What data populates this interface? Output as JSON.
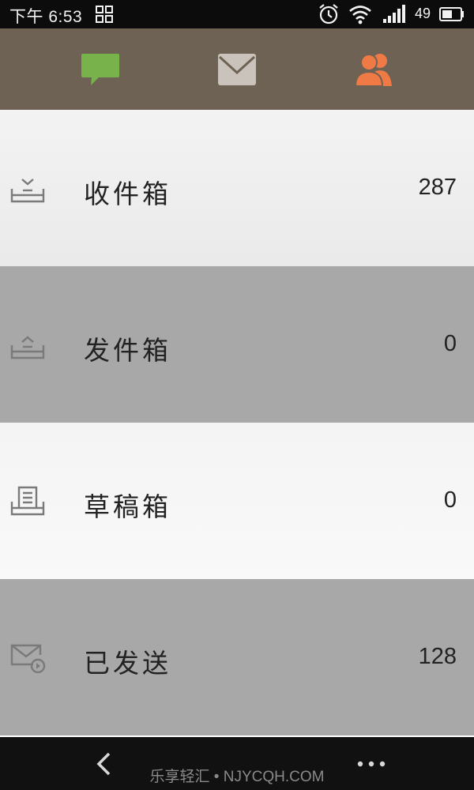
{
  "status_bar": {
    "time": "下午 6:53",
    "battery_level": "49",
    "icons": [
      "grid-icon",
      "alarm-icon",
      "wifi-icon",
      "signal-icon",
      "battery-icon"
    ]
  },
  "tabs": [
    {
      "name": "messages",
      "icon": "chat-bubble-icon",
      "color": "#77b24b"
    },
    {
      "name": "mail",
      "icon": "envelope-icon",
      "color": "#c9c3bb"
    },
    {
      "name": "contacts",
      "icon": "people-icon",
      "color": "#ef7a46"
    }
  ],
  "folders": [
    {
      "label": "收件箱",
      "count": "287",
      "icon": "inbox-icon"
    },
    {
      "label": "发件箱",
      "count": "0",
      "icon": "outbox-icon"
    },
    {
      "label": "草稿箱",
      "count": "0",
      "icon": "drafts-icon"
    },
    {
      "label": "已发送",
      "count": "128",
      "icon": "sent-icon"
    }
  ],
  "bottom_bar": {
    "watermark": "乐享轻汇 • NJYCQH.COM",
    "icons": [
      "back-icon",
      "more-icon"
    ]
  }
}
